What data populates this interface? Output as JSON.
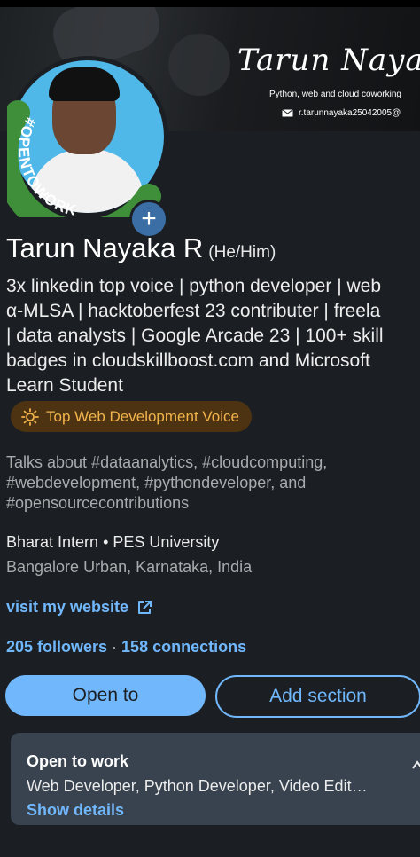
{
  "banner": {
    "name_script": "Tarun Nayak",
    "tagline": "Python, web and cloud coworking",
    "email": "r.tarunnayaka25042005@"
  },
  "avatar": {
    "frame_text": "#OPENTOWORK",
    "add_symbol": "+"
  },
  "profile": {
    "name": "Tarun Nayaka R",
    "pronouns": "(He/Him)",
    "headline_lines": [
      "3x linkedin top voice | python developer | web",
      "α-MLSA | hacktoberfest 23 contributer | freela",
      "| data analysts | Google Arcade 23 | 100+ skill",
      "badges in cloudskillboost.com and Microsoft",
      "Learn Student"
    ],
    "badge": "Top Web Development Voice",
    "talks_about": "Talks about #dataanalytics, #cloudcomputing, #webdevelopment, #pythondeveloper, and #opensourcecontributions",
    "company": "Bharat Intern • PES University",
    "location": "Bangalore Urban, Karnataka, India",
    "website_label": "visit my website",
    "followers": "205 followers",
    "separator": " · ",
    "connections": "158 connections"
  },
  "actions": {
    "open_to": "Open to",
    "add_section": "Add section"
  },
  "open_to_work": {
    "title": "Open to work",
    "roles": "Web Developer, Python Developer, Video Edit…",
    "show_details": "Show details"
  },
  "colors": {
    "background": "#1b1f23",
    "link": "#71b7fb",
    "badge_bg": "#4d3311",
    "badge_text": "#f1b34c",
    "otw_green": "#3f8f3a",
    "card_bg": "#38434f"
  }
}
